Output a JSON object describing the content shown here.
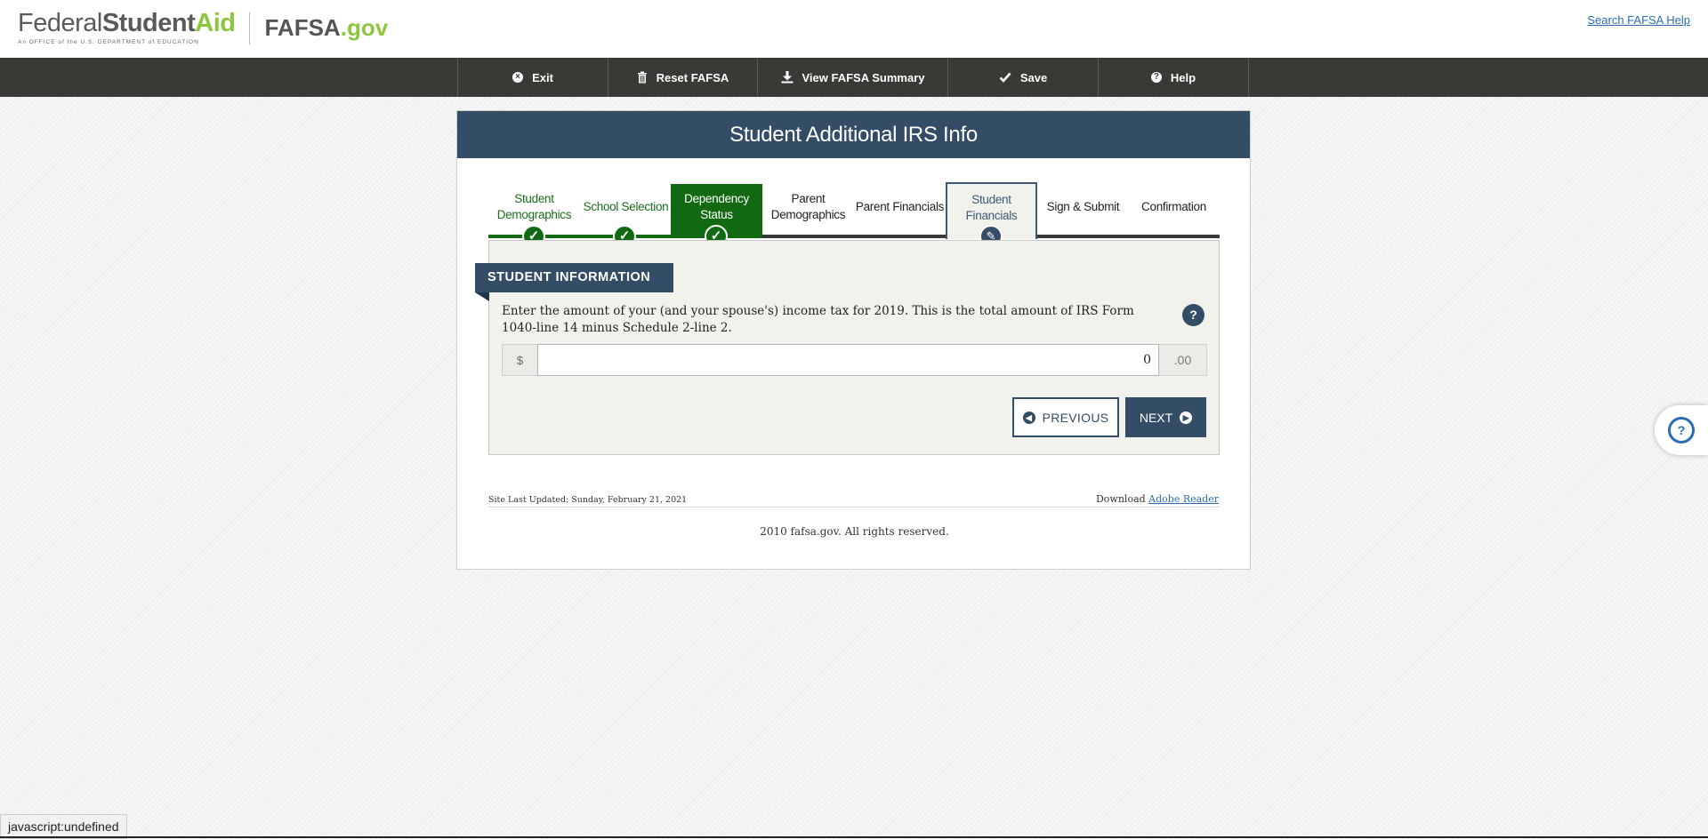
{
  "header": {
    "fsa_logo": {
      "part1": "Federal",
      "part2": "Student",
      "part3": "Aid",
      "tagline": "An OFFICE of the U.S. DEPARTMENT of EDUCATION"
    },
    "fafsa_logo": {
      "name": "FAFSA",
      "suffix": ".gov"
    },
    "search_help": "Search FAFSA Help"
  },
  "nav": [
    {
      "label": "Exit",
      "icon": "close-circle-icon"
    },
    {
      "label": "Reset FAFSA",
      "icon": "trash-icon"
    },
    {
      "label": "View FAFSA Summary",
      "icon": "download-icon"
    },
    {
      "label": "Save",
      "icon": "check-icon"
    },
    {
      "label": "Help",
      "icon": "question-circle-icon"
    }
  ],
  "page": {
    "title": "Student Additional IRS Info"
  },
  "steps": [
    {
      "label": "Student Demographics",
      "state": "done"
    },
    {
      "label": "School Selection",
      "state": "done"
    },
    {
      "label": "Dependency Status",
      "state": "done"
    },
    {
      "label": "Parent Demographics",
      "state": "future"
    },
    {
      "label": "Parent Financials",
      "state": "future"
    },
    {
      "label": "Student Financials",
      "state": "current"
    },
    {
      "label": "Sign & Submit",
      "state": "future"
    },
    {
      "label": "Confirmation",
      "state": "future"
    }
  ],
  "section": {
    "label": "STUDENT INFORMATION",
    "question": "Enter the amount of your (and your spouse's) income tax for 2019. This is the total amount of IRS Form 1040-line 14 minus Schedule 2-line 2.",
    "help": "?",
    "currency": "$",
    "amount": "0",
    "cents": ".00"
  },
  "buttons": {
    "previous": "PREVIOUS",
    "next": "NEXT"
  },
  "footer": {
    "last_updated": "Site Last Updated: Sunday, February 21, 2021",
    "download_prefix": "Download",
    "download_link": "Adobe Reader",
    "copyright": "2010 fafsa.gov. All rights reserved."
  },
  "status_bar": "javascript:undefined",
  "colors": {
    "navy": "#334d66",
    "green": "#116a11",
    "nav_bg": "#3a3935",
    "lime": "#8cc63f",
    "link": "#2a6db2"
  }
}
